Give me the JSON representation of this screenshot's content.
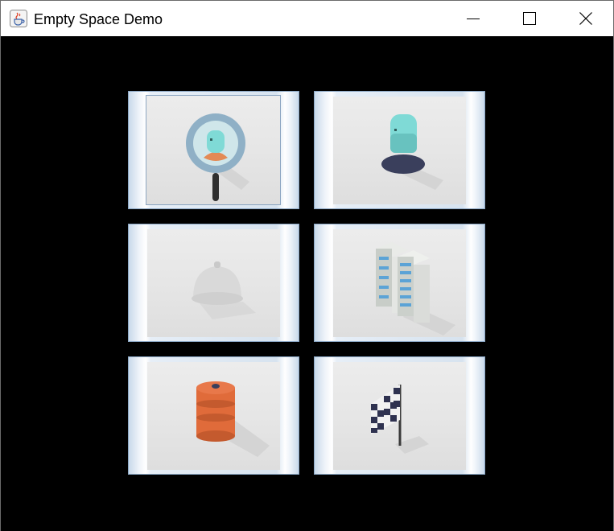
{
  "window": {
    "title": "Empty Space Demo",
    "app_icon": "java-cup-icon",
    "controls": [
      "minimize-icon",
      "maximize-icon",
      "close-icon"
    ]
  },
  "tiles": [
    {
      "icon": "search-user-icon",
      "focused": true
    },
    {
      "icon": "user-icon",
      "focused": false
    },
    {
      "icon": "service-bell-icon",
      "focused": false
    },
    {
      "icon": "office-buildings-icon",
      "focused": false
    },
    {
      "icon": "oil-barrel-icon",
      "focused": false
    },
    {
      "icon": "checkered-flag-icon",
      "focused": false
    }
  ],
  "colors": {
    "background": "#000000",
    "titlebar": "#ffffff",
    "tile_border": "#8aa6c4",
    "barrel": "#e06b3a",
    "head": "#7fdad6"
  }
}
